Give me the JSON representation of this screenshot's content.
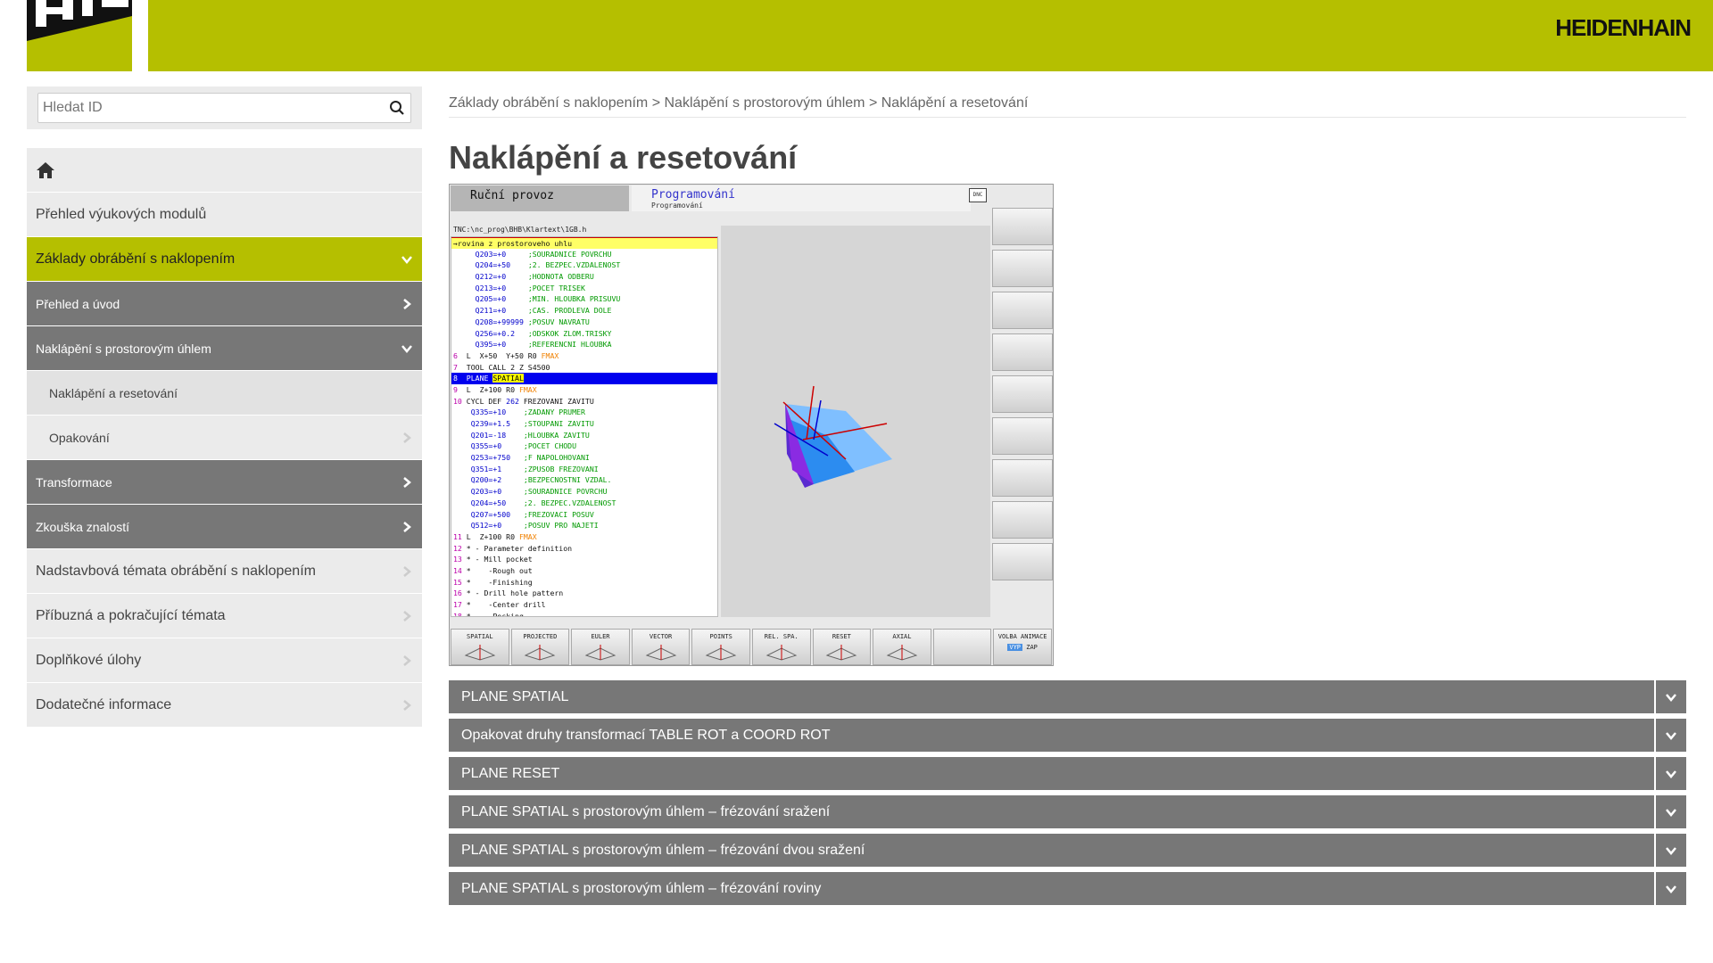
{
  "header": {
    "logo_alt": "HIT",
    "brand": "HEIDENHAIN"
  },
  "search": {
    "placeholder": "Hledat ID"
  },
  "sidebar": {
    "items": [
      {
        "label": "Přehled výukových modulů"
      },
      {
        "label": "Základy obrábění s naklopením"
      },
      {
        "label": "Přehled a úvod"
      },
      {
        "label": "Naklápění s prostorovým úhlem"
      },
      {
        "label": "Naklápění a resetování"
      },
      {
        "label": "Opakování"
      },
      {
        "label": "Transformace"
      },
      {
        "label": "Zkouška znalostí"
      },
      {
        "label": "Nadstavbová témata obrábění s naklopením"
      },
      {
        "label": "Příbuzná a pokračující témata"
      },
      {
        "label": "Doplňkové úlohy"
      },
      {
        "label": "Dodatečné informace"
      }
    ]
  },
  "breadcrumb": [
    "Základy obrábění s naklopením",
    "Naklápění s prostorovým úhlem",
    "Naklápění a resetování"
  ],
  "breadcrumb_sep": ">",
  "page_title": "Naklápění a resetování",
  "tnc": {
    "mode_left": "Ruční provoz",
    "mode_right": "Programování",
    "mode_right_sub": "Programování",
    "dnc": "DNC",
    "path": "TNC:\\nc_prog\\BHB\\Klartext\\1GB.h",
    "softkeys": [
      "SPATIAL",
      "PROJECTED",
      "EULER",
      "VECTOR",
      "POINTS",
      "REL. SPA.",
      "RESET",
      "AXIAL"
    ],
    "anim_label": "VOLBA ANIMACE",
    "anim_off": "VYP",
    "anim_on": "ZAP"
  },
  "accordions": [
    {
      "label": "PLANE SPATIAL"
    },
    {
      "label": "Opakovat druhy transformací TABLE ROT a COORD ROT"
    },
    {
      "label": "PLANE RESET"
    },
    {
      "label": "PLANE SPATIAL s prostorovým úhlem – frézování sražení"
    },
    {
      "label": "PLANE SPATIAL s prostorovým úhlem – frézování dvou sražení"
    },
    {
      "label": "PLANE SPATIAL s prostorovým úhlem – frézování roviny"
    }
  ],
  "colors": {
    "accent": "#b5bf00",
    "dark_item": "#777777"
  }
}
